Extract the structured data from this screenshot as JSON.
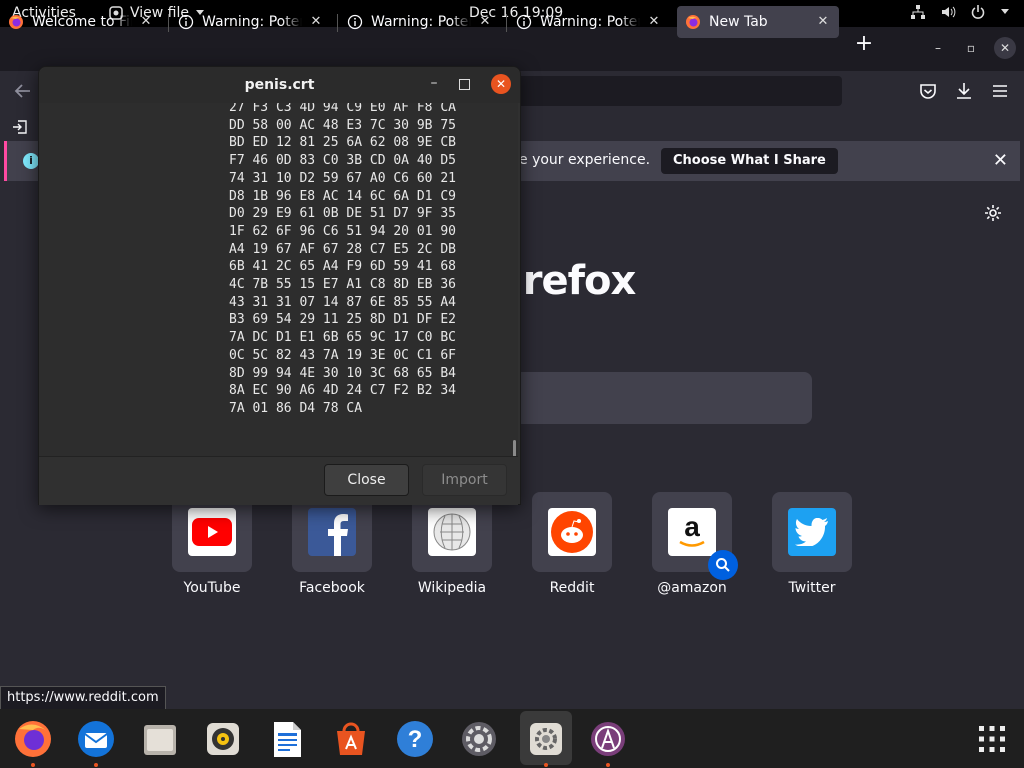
{
  "topbar": {
    "activities": "Activities",
    "app_menu": "View file",
    "clock": "Dec 16  19:09",
    "tray_icons": [
      "network-icon",
      "volume-icon",
      "power-icon",
      "chevron-down-icon"
    ]
  },
  "tabs": [
    {
      "label": "Welcome to Firefox",
      "icon": "firefox-icon",
      "active": false
    },
    {
      "label": "Warning: Potential Security Risk Ahead",
      "icon": "info-icon",
      "active": false
    },
    {
      "label": "Warning: Potential Security Risk Ahead",
      "icon": "info-icon",
      "active": false
    },
    {
      "label": "Warning: Potential Security Risk Ahead",
      "icon": "info-icon",
      "active": false
    },
    {
      "label": "New Tab",
      "icon": "firefox-icon",
      "active": true
    }
  ],
  "notification": {
    "text": "e your experience.",
    "button": "Choose What I Share"
  },
  "newtab": {
    "brand": "irefox",
    "top_sites": [
      {
        "label": "YouTube",
        "icon": "youtube-icon"
      },
      {
        "label": "Facebook",
        "icon": "facebook-icon"
      },
      {
        "label": "Wikipedia",
        "icon": "wikipedia-icon"
      },
      {
        "label": "Reddit",
        "icon": "reddit-icon"
      },
      {
        "label": "@amazon",
        "icon": "amazon-icon"
      },
      {
        "label": "Twitter",
        "icon": "twitter-icon"
      }
    ]
  },
  "status_url": "https://www.reddit.com",
  "dialog": {
    "title": "penis.crt",
    "hex_lines": [
      "27 F3 C3 4D 94 C9 E0 AF F8 CA",
      "DD 58 00 AC 48 E3 7C 30 9B 75",
      "BD ED 12 81 25 6A 62 08 9E CB",
      "F7 46 0D 83 C0 3B CD 0A 40 D5",
      "74 31 10 D2 59 67 A0 C6 60 21",
      "D8 1B 96 E8 AC 14 6C 6A D1 C9",
      "D0 29 E9 61 0B DE 51 D7 9F 35",
      "1F 62 6F 96 C6 51 94 20 01 90",
      "A4 19 67 AF 67 28 C7 E5 2C DB",
      "6B 41 2C 65 A4 F9 6D 59 41 68",
      "4C 7B 55 15 E7 A1 C8 8D EB 36",
      "43 31 31 07 14 87 6E 85 55 A4",
      "B3 69 54 29 11 25 8D D1 DF E2",
      "7A DC D1 E1 6B 65 9C 17 C0 BC",
      "0C 5C 82 43 7A 19 3E 0C C1 6F",
      "8D 99 94 4E 30 10 3C 68 65 B4",
      "8A EC 90 A6 4D 24 C7 F2 B2 34",
      "7A 01 86 D4 78 CA"
    ],
    "close_label": "Close",
    "import_label": "Import"
  },
  "dock": [
    "firefox-icon",
    "thunderbird-icon",
    "files-icon",
    "rhythmbox-icon",
    "writer-icon",
    "software-icon",
    "help-icon",
    "software-updater-icon",
    "settings-icon",
    "app-icon",
    "show-apps-icon"
  ],
  "colors": {
    "accent": "#e95420",
    "firefox_bg": "#2b2a33",
    "notification_stripe": "#ff4aa2"
  }
}
